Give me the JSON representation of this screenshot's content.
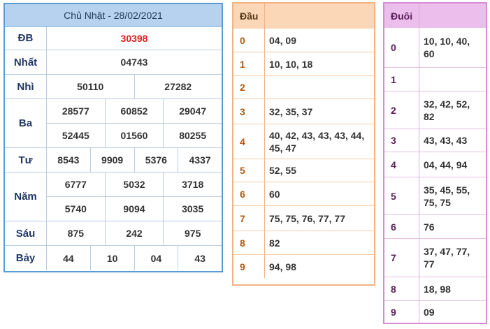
{
  "results": {
    "title": "Chủ Nhật - 28/02/2021",
    "special_color": "#e31b1b",
    "prizes": [
      {
        "label": "ĐB",
        "lines": [
          [
            "30398"
          ]
        ]
      },
      {
        "label": "Nhất",
        "lines": [
          [
            "04743"
          ]
        ]
      },
      {
        "label": "Nhì",
        "lines": [
          [
            "50110",
            "27282"
          ]
        ]
      },
      {
        "label": "Ba",
        "lines": [
          [
            "28577",
            "60852",
            "29047"
          ],
          [
            "52445",
            "01560",
            "80255"
          ]
        ]
      },
      {
        "label": "Tư",
        "lines": [
          [
            "8543",
            "9909",
            "5376",
            "4337"
          ]
        ]
      },
      {
        "label": "Năm",
        "lines": [
          [
            "6777",
            "5032",
            "3718"
          ],
          [
            "5740",
            "9094",
            "3035"
          ]
        ]
      },
      {
        "label": "Sáu",
        "lines": [
          [
            "875",
            "242",
            "975"
          ]
        ]
      },
      {
        "label": "Bảy",
        "lines": [
          [
            "44",
            "10",
            "04",
            "43"
          ]
        ]
      }
    ]
  },
  "dau": {
    "header": "Đầu",
    "rows": [
      {
        "key": "0",
        "value": "04, 09"
      },
      {
        "key": "1",
        "value": "10, 10, 18"
      },
      {
        "key": "2",
        "value": ""
      },
      {
        "key": "3",
        "value": "32, 35, 37"
      },
      {
        "key": "4",
        "value": "40, 42, 43, 43, 43, 44, 45, 47"
      },
      {
        "key": "5",
        "value": "52, 55"
      },
      {
        "key": "6",
        "value": "60"
      },
      {
        "key": "7",
        "value": "75, 75, 76, 77, 77"
      },
      {
        "key": "8",
        "value": "82"
      },
      {
        "key": "9",
        "value": "94, 98"
      }
    ]
  },
  "duoi": {
    "header": "Đuôi",
    "rows": [
      {
        "key": "0",
        "value": "10, 10, 40, 60"
      },
      {
        "key": "1",
        "value": ""
      },
      {
        "key": "2",
        "value": "32, 42, 52, 82"
      },
      {
        "key": "3",
        "value": "43, 43, 43"
      },
      {
        "key": "4",
        "value": "04, 44, 94"
      },
      {
        "key": "5",
        "value": "35, 45, 55, 75, 75"
      },
      {
        "key": "6",
        "value": "76"
      },
      {
        "key": "7",
        "value": "37, 47, 77, 77"
      },
      {
        "key": "8",
        "value": "18, 98"
      },
      {
        "key": "9",
        "value": "09"
      }
    ]
  }
}
